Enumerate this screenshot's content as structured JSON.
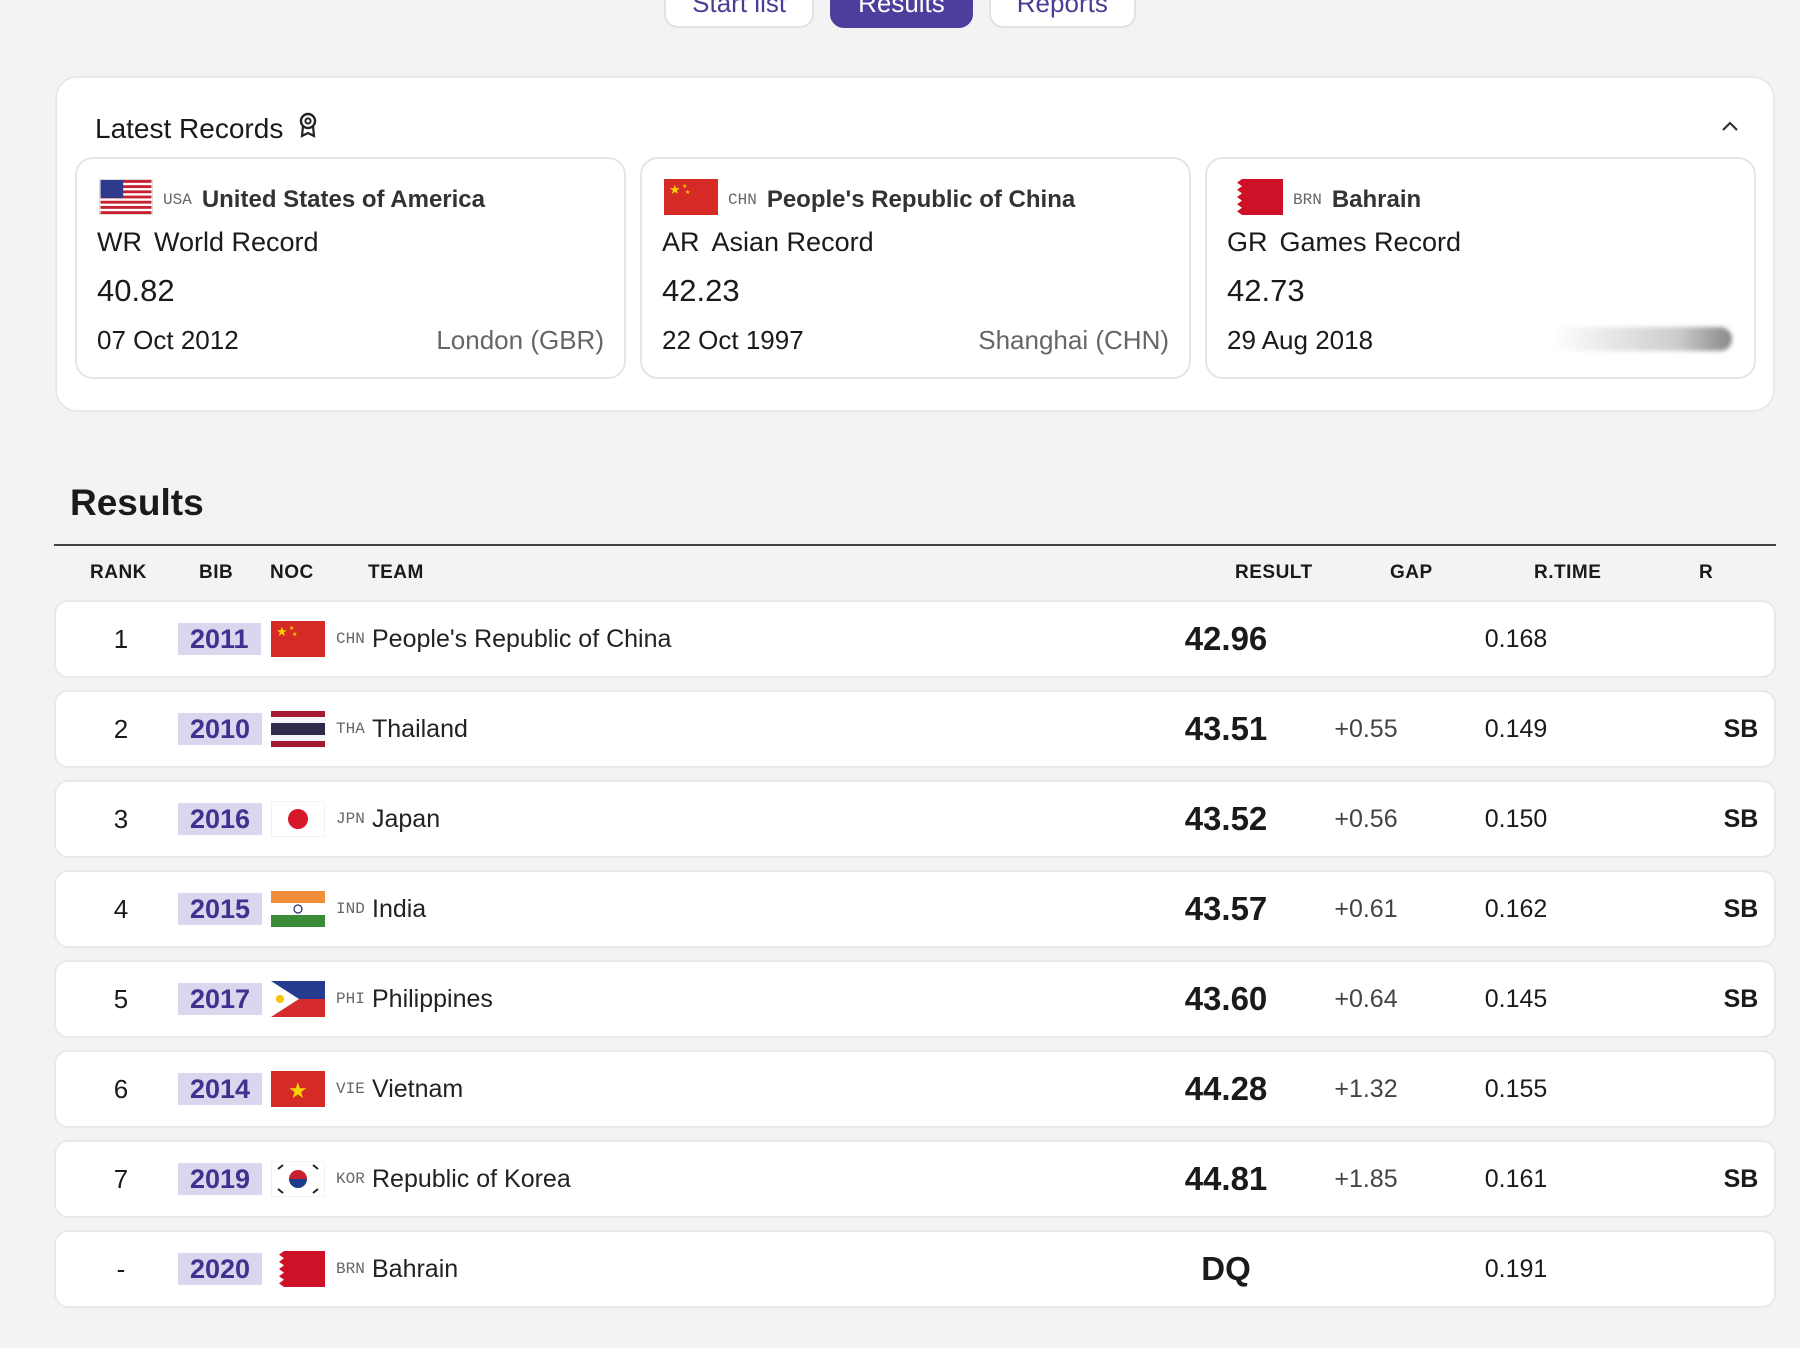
{
  "tabs": [
    "Start list",
    "Results",
    "Reports"
  ],
  "records": {
    "title": "Latest Records",
    "collapse_icon": "chevron-up-icon",
    "cards": [
      {
        "code": "USA",
        "country": "United States of America",
        "abbr": "WR",
        "type": "World Record",
        "value": "40.82",
        "date": "07 Oct 2012",
        "place": "London (GBR)"
      },
      {
        "code": "CHN",
        "country": "People's Republic of China",
        "abbr": "AR",
        "type": "Asian Record",
        "value": "42.23",
        "date": "22 Oct 1997",
        "place": "Shanghai (CHN)"
      },
      {
        "code": "BRN",
        "country": "Bahrain",
        "abbr": "GR",
        "type": "Games Record",
        "value": "42.73",
        "date": "29 Aug 2018",
        "place": ""
      }
    ]
  },
  "results": {
    "title": "Results",
    "headers": {
      "rank": "RANK",
      "bib": "BIB",
      "noc": "NOC",
      "team": "TEAM",
      "result": "RESULT",
      "gap": "GAP",
      "rtime": "R.TIME",
      "r": "R"
    },
    "rows": [
      {
        "rank": "1",
        "bib": "2011",
        "noc": "CHN",
        "team": "People's Republic of China",
        "result": "42.96",
        "gap": "",
        "rtime": "0.168",
        "r": ""
      },
      {
        "rank": "2",
        "bib": "2010",
        "noc": "THA",
        "team": "Thailand",
        "result": "43.51",
        "gap": "+0.55",
        "rtime": "0.149",
        "r": "SB"
      },
      {
        "rank": "3",
        "bib": "2016",
        "noc": "JPN",
        "team": "Japan",
        "result": "43.52",
        "gap": "+0.56",
        "rtime": "0.150",
        "r": "SB"
      },
      {
        "rank": "4",
        "bib": "2015",
        "noc": "IND",
        "team": "India",
        "result": "43.57",
        "gap": "+0.61",
        "rtime": "0.162",
        "r": "SB"
      },
      {
        "rank": "5",
        "bib": "2017",
        "noc": "PHI",
        "team": "Philippines",
        "result": "43.60",
        "gap": "+0.64",
        "rtime": "0.145",
        "r": "SB"
      },
      {
        "rank": "6",
        "bib": "2014",
        "noc": "VIE",
        "team": "Vietnam",
        "result": "44.28",
        "gap": "+1.32",
        "rtime": "0.155",
        "r": ""
      },
      {
        "rank": "7",
        "bib": "2019",
        "noc": "KOR",
        "team": "Republic of Korea",
        "result": "44.81",
        "gap": "+1.85",
        "rtime": "0.161",
        "r": "SB"
      },
      {
        "rank": "-",
        "bib": "2020",
        "noc": "BRN",
        "team": "Bahrain",
        "result": "DQ",
        "gap": "",
        "rtime": "0.191",
        "r": ""
      }
    ]
  }
}
